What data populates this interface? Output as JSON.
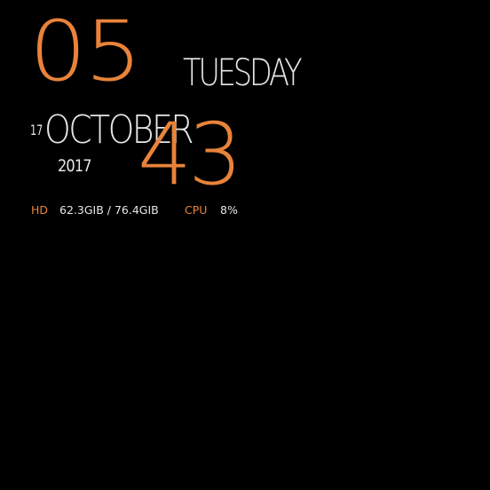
{
  "clock": {
    "hour": "05",
    "minute": "43"
  },
  "date": {
    "weekday": "TUESDAY",
    "day": "17",
    "month": "OCTOBER",
    "year": "2017"
  },
  "stats": {
    "hd_label": "HD",
    "hd_value": "62.3GIB / 76.4GIB",
    "cpu_label": "CPU",
    "cpu_value": "8%"
  },
  "colors": {
    "background": "#000000",
    "accent": "#e8833a",
    "text": "#e6e6e6"
  }
}
